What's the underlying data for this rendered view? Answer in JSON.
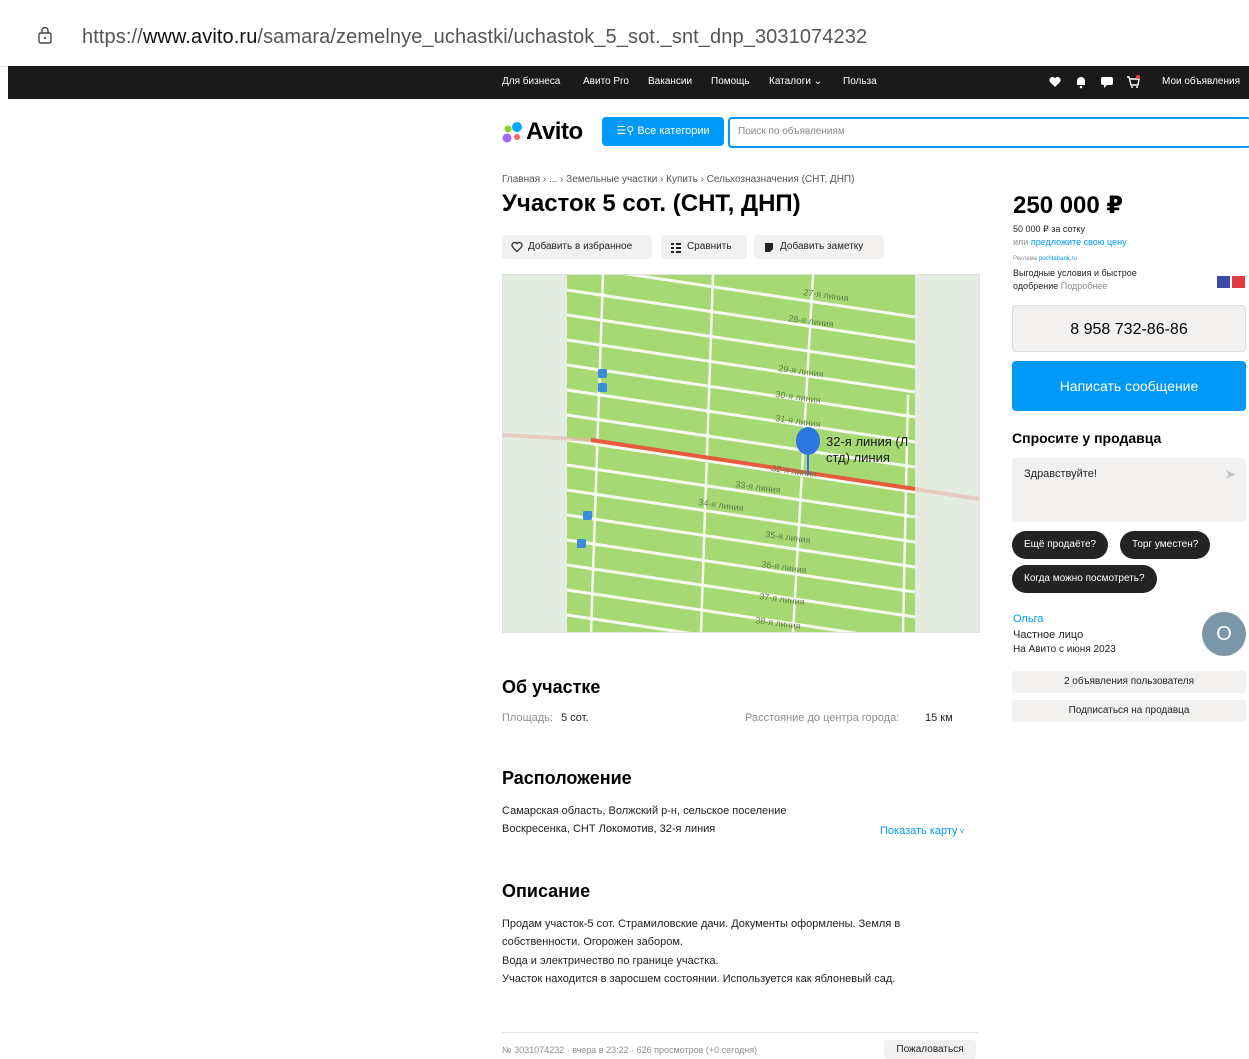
{
  "browser": {
    "url_prefix": "https://",
    "url_domain": "www.avito.ru",
    "url_path": "/samara/zemelnye_uchastki/uchastok_5_sot._snt_dnp_3031074232"
  },
  "topnav": {
    "links": [
      "Для бизнеса",
      "Авито Pro",
      "Вакансии",
      "Помощь",
      "Каталоги",
      "Польза"
    ],
    "my_ads": "Мои объявления"
  },
  "header": {
    "logo": "Avito",
    "all_categories": "Все категории",
    "search_placeholder": "Поиск по объявлениям"
  },
  "breadcrumbs": "Главная › ... › Земельные участки › Купить › Сельхозназначения (СНТ, ДНП)",
  "title": "Участок 5 сот. (СНТ, ДНП)",
  "actions": {
    "favorite": "Добавить в избранное",
    "compare": "Сравнить",
    "note": "Добавить заметку"
  },
  "map": {
    "pin_label_1": "32-я линия (Л",
    "pin_label_2": "стд) линия",
    "street_labels": [
      "27-я линия",
      "28-я линия",
      "29-я линия",
      "30-я линия",
      "31-я линия",
      "32-я линия",
      "33-я линия",
      "34-я линия",
      "35-я линия",
      "36-я линия",
      "37-я линия",
      "38-я линия"
    ]
  },
  "about": {
    "heading": "Об участке",
    "area_label": "Площадь:",
    "area_value": "5 сот.",
    "distance_label": "Расстояние до центра города:",
    "distance_value": "15 км"
  },
  "location": {
    "heading": "Расположение",
    "line1": "Самарская область, Волжский р-н, сельское поселение",
    "line2": "Воскресенка, СНТ Локомотив, 32-я линия",
    "show_map": "Показать карту"
  },
  "description": {
    "heading": "Описание",
    "lines": [
      "Продам участок-5 сот. Страмиловские дачи. Документы оформлены. Земля в",
      "собственности. Огорожен забором.",
      "Вода и электричество по границе участка.",
      "Участок находится в заросшем состоянии. Используется как яблоневый сад."
    ]
  },
  "footer": {
    "meta": "№ 3031074232 · вчера в 23:22 · 626 просмотров (+0 сегодня)",
    "complain": "Пожаловаться"
  },
  "sidebar": {
    "price": "250 000 ₽",
    "price_per": "50 000 ₽ за сотку",
    "offer_prefix": "или",
    "offer_link": "предложите свою цену",
    "ad_label": "Реклама",
    "ad_domain": "pochtabank.ru",
    "ad_text1": "Выгодные условия и быстрое",
    "ad_text2": "одобрение",
    "ad_more": "Подробнее",
    "phone": "8 958 732-86-86",
    "write_message": "Написать сообщение",
    "ask_title": "Спросите у продавца",
    "ask_text": "Здравствуйте!",
    "chips": [
      "Ещё продаёте?",
      "Торг уместен?",
      "Когда можно посмотреть?"
    ],
    "seller_name": "Ольга",
    "seller_type": "Частное лицо",
    "seller_since": "На Авито с июня 2023",
    "avatar_letter": "О",
    "user_ads": "2 объявления пользователя",
    "subscribe": "Подписаться на продавца"
  },
  "colors": {
    "accent": "#0099f7",
    "nav_bg": "#1a1a1a",
    "map_green": "#a6d873",
    "route_red": "#e85a3d"
  }
}
